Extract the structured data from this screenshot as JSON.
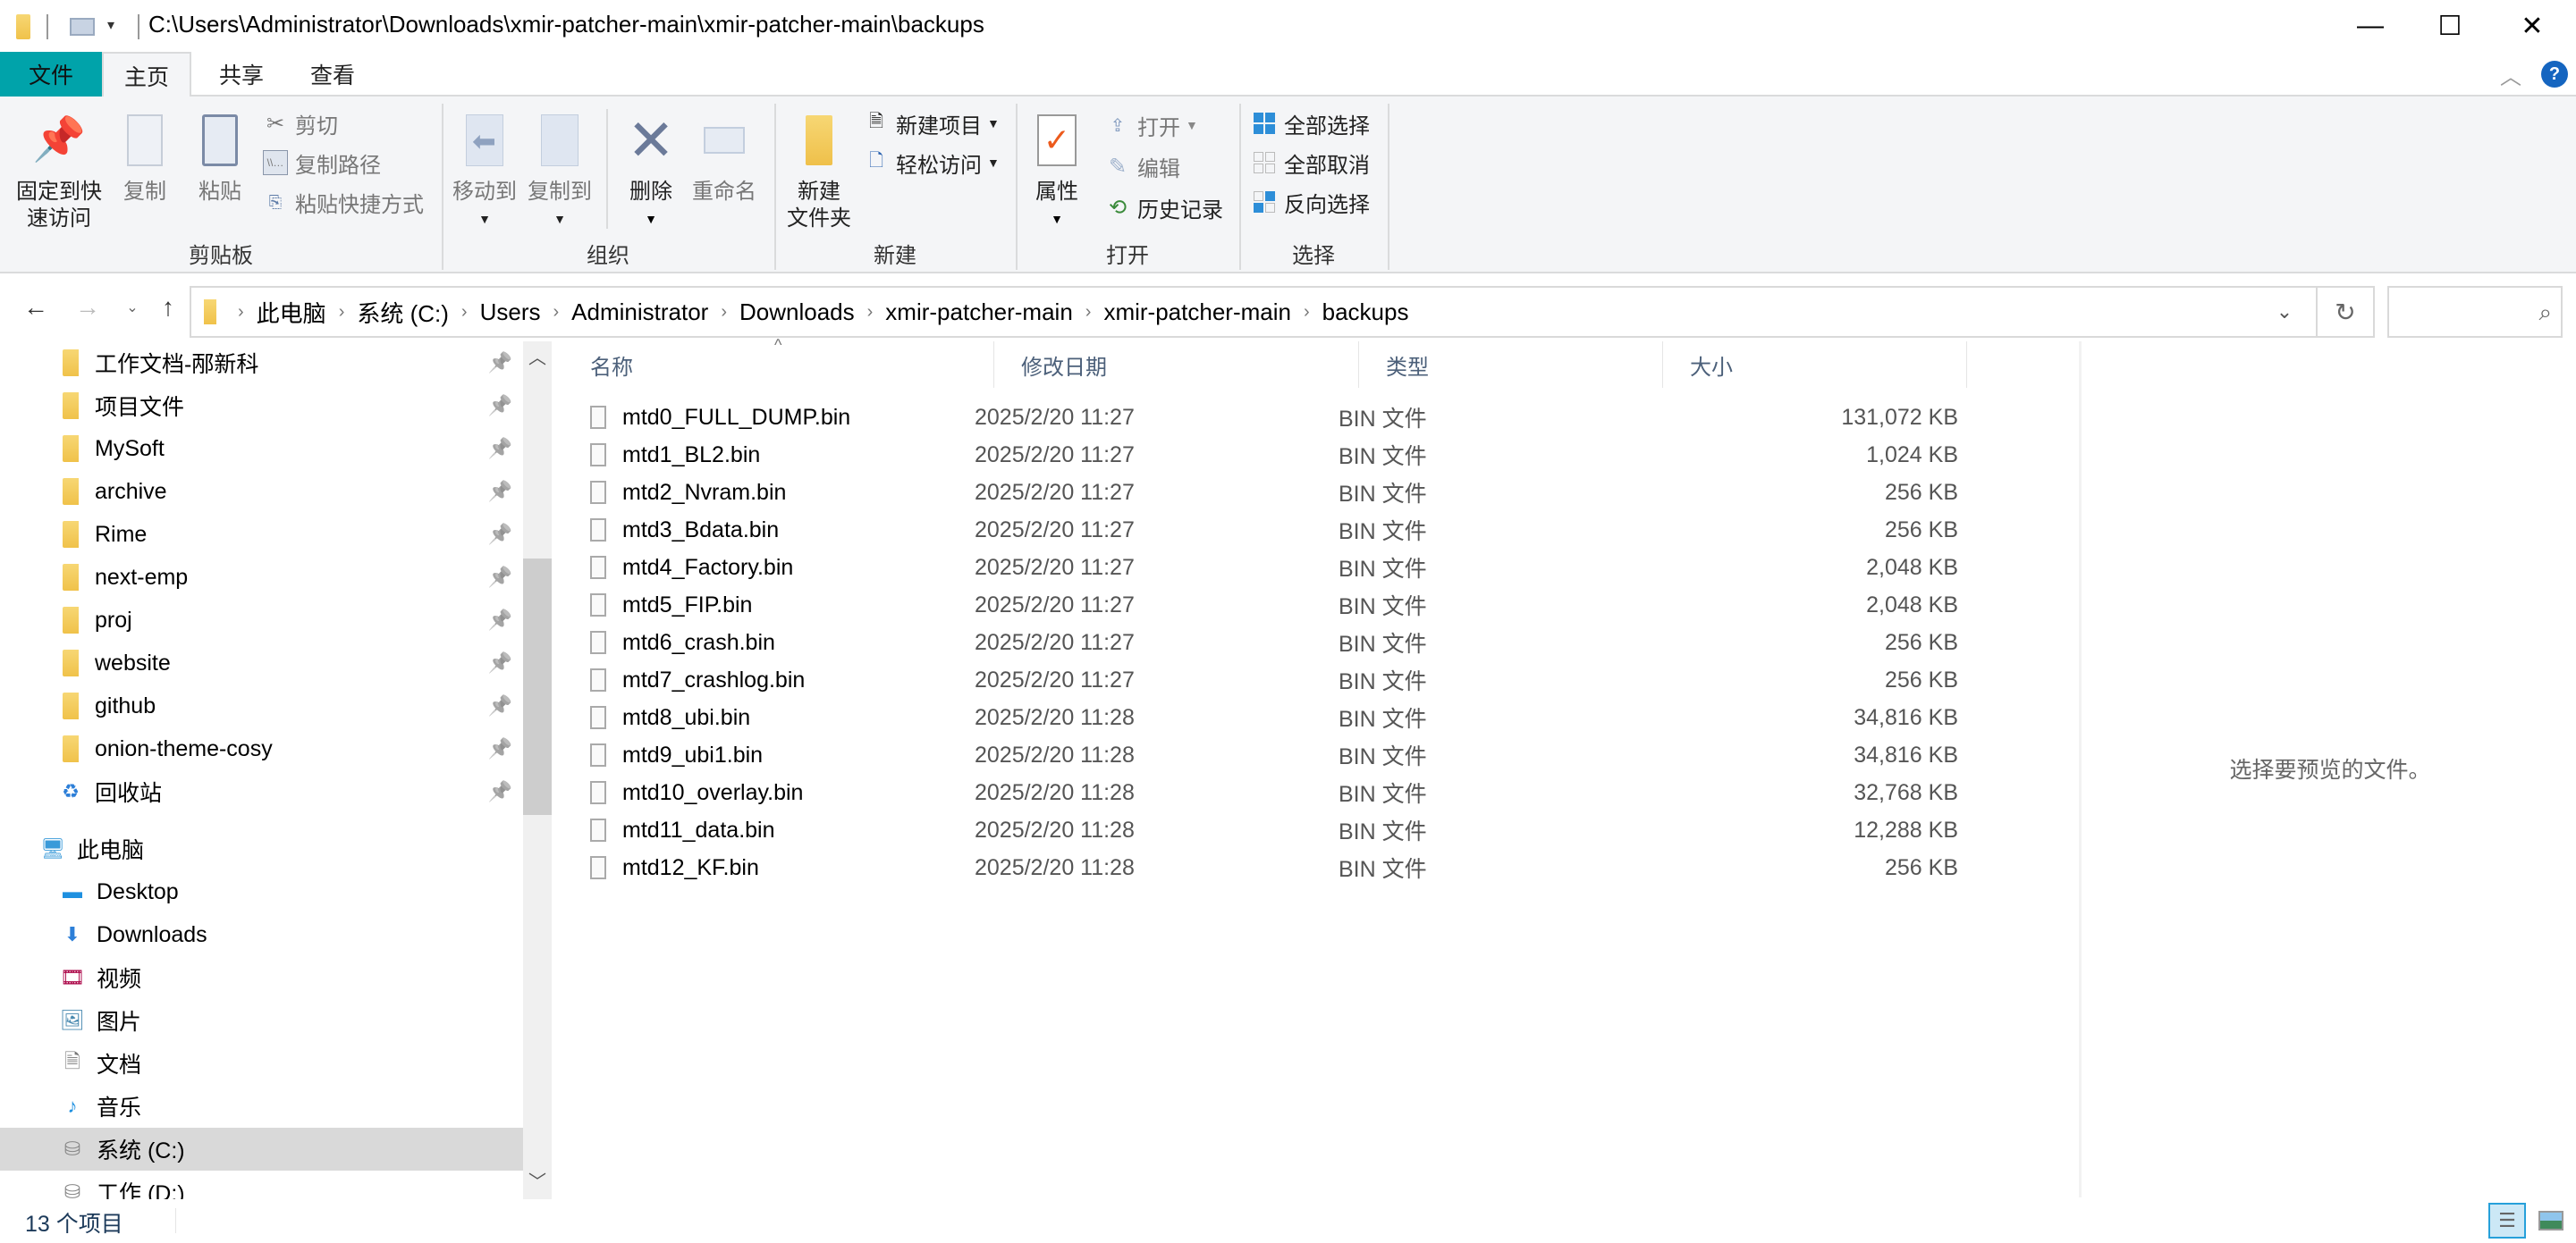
{
  "window": {
    "title_path": "C:\\Users\\Administrator\\Downloads\\xmir-patcher-main\\xmir-patcher-main\\backups",
    "controls": {
      "minimize": "—",
      "maximize": "☐",
      "close": "✕"
    }
  },
  "ribbon_tabs": [
    {
      "label": "文件"
    },
    {
      "label": "主页"
    },
    {
      "label": "共享"
    },
    {
      "label": "查看"
    }
  ],
  "ribbon": {
    "clipboard": {
      "group_label": "剪贴板",
      "pin_quick_access": "固定到快\n速访问",
      "pin_line1": "固定到快",
      "pin_line2": "速访问",
      "copy": "复制",
      "paste": "粘贴",
      "cut": "剪切",
      "copy_path": "复制路径",
      "paste_shortcut": "粘贴快捷方式"
    },
    "organize": {
      "group_label": "组织",
      "move_to": "移动到",
      "copy_to": "复制到",
      "delete": "删除",
      "rename": "重命名"
    },
    "new": {
      "group_label": "新建",
      "new_folder_line1": "新建",
      "new_folder_line2": "文件夹",
      "new_item": "新建项目",
      "easy_access": "轻松访问"
    },
    "open": {
      "group_label": "打开",
      "properties": "属性",
      "open": "打开",
      "edit": "编辑",
      "history": "历史记录"
    },
    "select": {
      "group_label": "选择",
      "select_all": "全部选择",
      "select_none": "全部取消",
      "invert_selection": "反向选择"
    }
  },
  "address_bar": {
    "breadcrumbs": [
      "此电脑",
      "系统 (C:)",
      "Users",
      "Administrator",
      "Downloads",
      "xmir-patcher-main",
      "xmir-patcher-main",
      "backups"
    ],
    "search_placeholder": ""
  },
  "sidebar": {
    "quick_access": [
      {
        "label": "工作文档-邴新科",
        "icon": "folder-icon",
        "pinned": true
      },
      {
        "label": "项目文件",
        "icon": "folder-icon",
        "pinned": true
      },
      {
        "label": "MySoft",
        "icon": "folder-icon",
        "pinned": true
      },
      {
        "label": "archive",
        "icon": "folder-icon",
        "pinned": true
      },
      {
        "label": "Rime",
        "icon": "folder-icon",
        "pinned": true
      },
      {
        "label": "next-emp",
        "icon": "folder-icon",
        "pinned": true
      },
      {
        "label": "proj",
        "icon": "folder-icon",
        "pinned": true
      },
      {
        "label": "website",
        "icon": "folder-icon",
        "pinned": true
      },
      {
        "label": "github",
        "icon": "folder-icon",
        "pinned": true
      },
      {
        "label": "onion-theme-cosy",
        "icon": "folder-icon",
        "pinned": true
      },
      {
        "label": "回收站",
        "icon": "recycle-bin-icon",
        "pinned": true
      }
    ],
    "this_pc": {
      "label": "此电脑",
      "icon": "computer-icon"
    },
    "pc_items": [
      {
        "label": "Desktop",
        "icon": "desktop-icon"
      },
      {
        "label": "Downloads",
        "icon": "download-icon"
      },
      {
        "label": "视频",
        "icon": "video-icon"
      },
      {
        "label": "图片",
        "icon": "picture-icon"
      },
      {
        "label": "文档",
        "icon": "document-icon"
      },
      {
        "label": "音乐",
        "icon": "music-icon"
      },
      {
        "label": "系统 (C:)",
        "icon": "system-drive-icon",
        "selected": true
      },
      {
        "label": "工作 (D:)",
        "icon": "drive-icon"
      }
    ]
  },
  "file_list": {
    "columns": {
      "name": "名称",
      "modified": "修改日期",
      "type": "类型",
      "size": "大小"
    },
    "sort": {
      "column": "name",
      "direction": "ascending"
    },
    "files": [
      {
        "name": "mtd0_FULL_DUMP.bin",
        "modified": "2025/2/20 11:27",
        "type": "BIN 文件",
        "size": "131,072 KB"
      },
      {
        "name": "mtd1_BL2.bin",
        "modified": "2025/2/20 11:27",
        "type": "BIN 文件",
        "size": "1,024 KB"
      },
      {
        "name": "mtd2_Nvram.bin",
        "modified": "2025/2/20 11:27",
        "type": "BIN 文件",
        "size": "256 KB"
      },
      {
        "name": "mtd3_Bdata.bin",
        "modified": "2025/2/20 11:27",
        "type": "BIN 文件",
        "size": "256 KB"
      },
      {
        "name": "mtd4_Factory.bin",
        "modified": "2025/2/20 11:27",
        "type": "BIN 文件",
        "size": "2,048 KB"
      },
      {
        "name": "mtd5_FIP.bin",
        "modified": "2025/2/20 11:27",
        "type": "BIN 文件",
        "size": "2,048 KB"
      },
      {
        "name": "mtd6_crash.bin",
        "modified": "2025/2/20 11:27",
        "type": "BIN 文件",
        "size": "256 KB"
      },
      {
        "name": "mtd7_crashlog.bin",
        "modified": "2025/2/20 11:27",
        "type": "BIN 文件",
        "size": "256 KB"
      },
      {
        "name": "mtd8_ubi.bin",
        "modified": "2025/2/20 11:28",
        "type": "BIN 文件",
        "size": "34,816 KB"
      },
      {
        "name": "mtd9_ubi1.bin",
        "modified": "2025/2/20 11:28",
        "type": "BIN 文件",
        "size": "34,816 KB"
      },
      {
        "name": "mtd10_overlay.bin",
        "modified": "2025/2/20 11:28",
        "type": "BIN 文件",
        "size": "32,768 KB"
      },
      {
        "name": "mtd11_data.bin",
        "modified": "2025/2/20 11:28",
        "type": "BIN 文件",
        "size": "12,288 KB"
      },
      {
        "name": "mtd12_KF.bin",
        "modified": "2025/2/20 11:28",
        "type": "BIN 文件",
        "size": "256 KB"
      }
    ]
  },
  "preview_pane": {
    "message": "选择要预览的文件。"
  },
  "status_bar": {
    "item_count": "13 个项目"
  },
  "colors": {
    "file_tab": "#00a3aa",
    "selection": "#d9d9d9",
    "accent_blue": "#26a0da",
    "help": "#1565c0"
  }
}
